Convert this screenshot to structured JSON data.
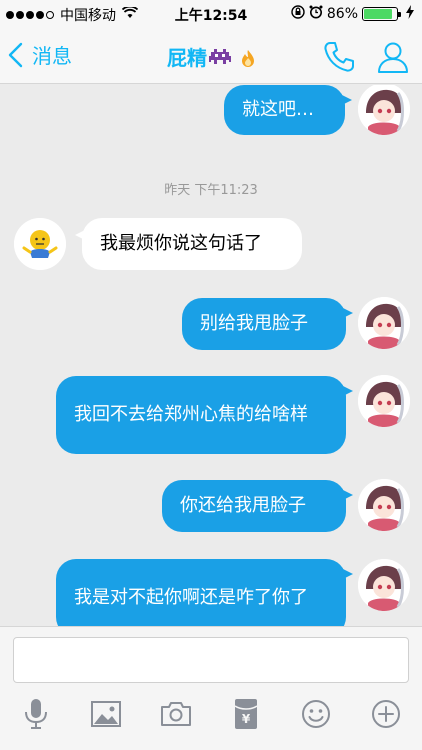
{
  "status": {
    "carrier": "中国移动",
    "time": "上午12:54",
    "battery": "86%",
    "battery_level": 0.86
  },
  "nav": {
    "back_label": "消息",
    "title": "屁精"
  },
  "chat": {
    "timestamp": "昨天 下午11:23",
    "messages": [
      {
        "sender": "me",
        "text": "就这吧…"
      },
      {
        "sender": "them",
        "text": "我最烦你说这句话了"
      },
      {
        "sender": "me",
        "text": "别给我甩脸子"
      },
      {
        "sender": "me",
        "text": "我回不去给郑州心焦的给啥样"
      },
      {
        "sender": "me",
        "text": "你还给我甩脸子"
      },
      {
        "sender": "me",
        "text": "我是对不起你啊还是咋了你了"
      }
    ]
  },
  "input": {
    "value": "",
    "placeholder": ""
  },
  "toolbar": {
    "icons": [
      "microphone-icon",
      "image-icon",
      "camera-icon",
      "red-packet-icon",
      "emoji-icon",
      "plus-icon"
    ]
  },
  "colors": {
    "accent": "#12b7f5",
    "my_bubble": "#1aa0e6",
    "their_bubble": "#ffffff"
  }
}
